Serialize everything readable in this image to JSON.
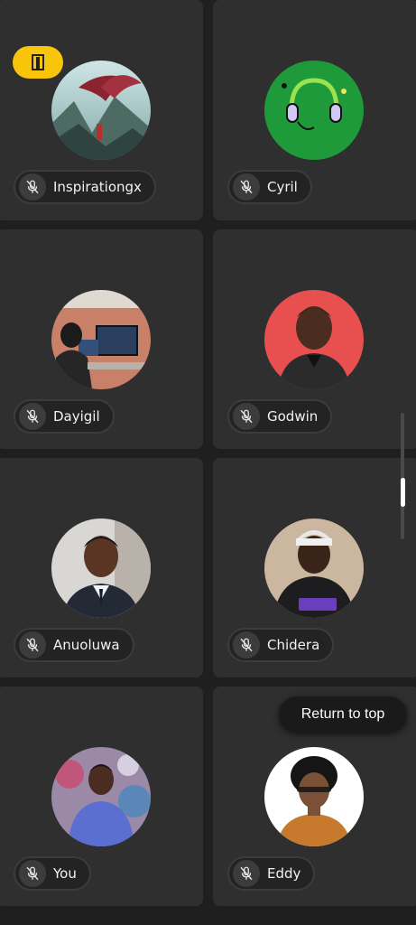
{
  "participants": [
    {
      "name": "Inspirationgx",
      "muted": true,
      "host": true,
      "avatar": "dragon-art-avatar"
    },
    {
      "name": "Cyril",
      "muted": true,
      "avatar": "headphones-avatar",
      "avatar_color": "#1e9a3b"
    },
    {
      "name": "Dayigil",
      "muted": true,
      "avatar": "desk-photo-avatar"
    },
    {
      "name": "Godwin",
      "muted": true,
      "avatar": "portrait-avatar",
      "avatar_color": "#e8504f"
    },
    {
      "name": "Anuoluwa",
      "muted": true,
      "avatar": "portrait-avatar"
    },
    {
      "name": "Chidera",
      "muted": true,
      "avatar": "portrait-avatar"
    },
    {
      "name": "You",
      "muted": true,
      "avatar": "portrait-avatar"
    },
    {
      "name": "Eddy",
      "muted": true,
      "avatar": "cartoon-avatar"
    }
  ],
  "return_to_top": "Return to top",
  "colors": {
    "background": "#1f1f1f",
    "tile": "#2f2f2f",
    "host_badge": "#f9c50b"
  },
  "icons": {
    "mute": "mic-off-icon",
    "host": "door-icon"
  }
}
